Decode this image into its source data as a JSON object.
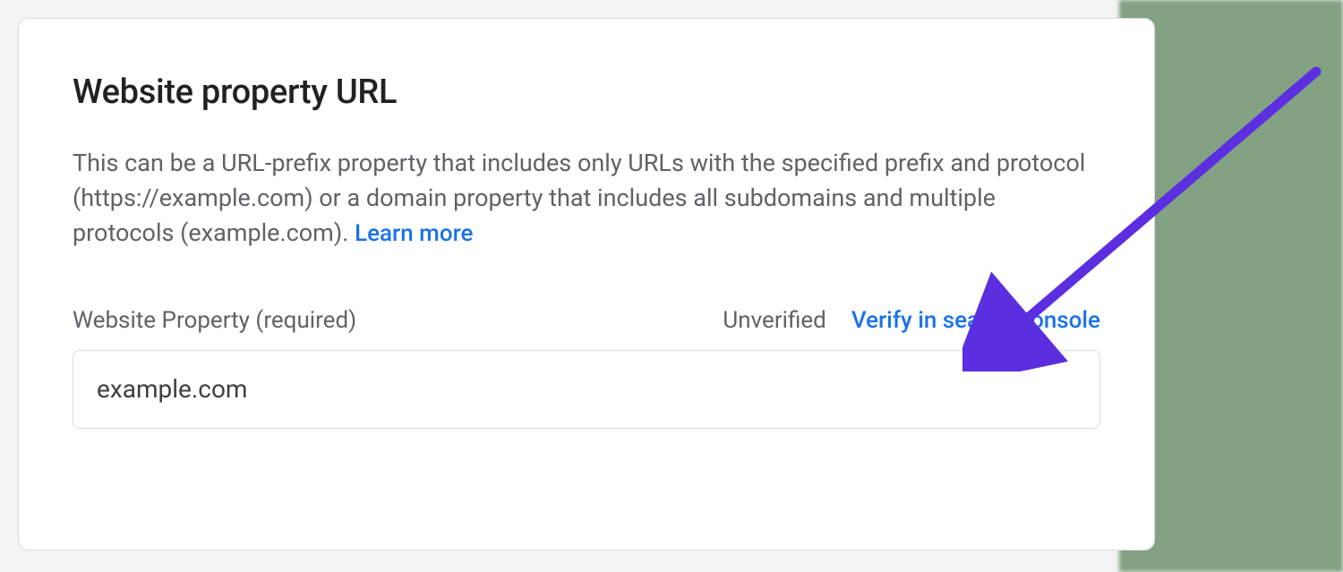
{
  "card": {
    "title": "Website property URL",
    "description": "This can be a URL-prefix property that includes only URLs with the specified prefix and protocol (https://example.com) or a domain property that includes all subdomains and multiple protocols (example.com). ",
    "learn_more_label": "Learn more"
  },
  "field": {
    "label": "Website Property (required)",
    "status": "Unverified",
    "verify_link_label": "Verify in search console",
    "value": "example.com"
  },
  "colors": {
    "link": "#1a73e8",
    "arrow": "#5b2ee0",
    "text_primary": "#202124",
    "text_secondary": "#5f6368",
    "border": "#dadce0"
  }
}
